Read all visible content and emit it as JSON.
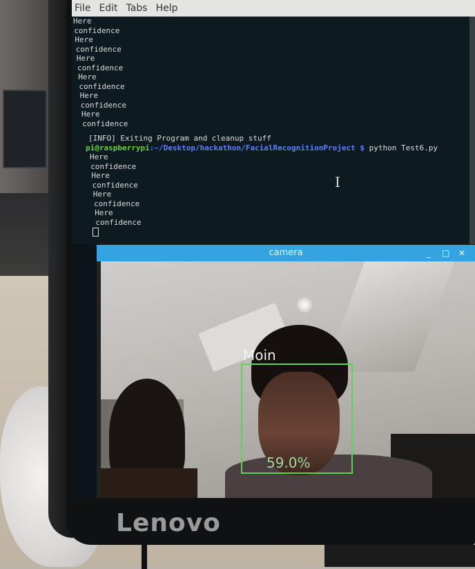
{
  "menu": [
    "File",
    "Edit",
    "Tabs",
    "Help"
  ],
  "terminal": {
    "lines_before": [
      "Here",
      "confidence",
      "Here",
      "confidence",
      "Here",
      "confidence",
      "Here",
      "confidence",
      "Here",
      "confidence",
      "Here",
      "confidence"
    ],
    "info_line": "[INFO] Exiting Program and cleanup stuff",
    "prompt_user": "pi@raspberrypi",
    "prompt_path": ":~/Desktop/hackathon/FacialRecognitionProject $",
    "command": " python Test6.py",
    "lines_after": [
      "Here",
      "confidence",
      "Here",
      "confidence",
      "Here",
      "confidence",
      "Here",
      "confidence"
    ]
  },
  "camera_window": {
    "title": "camera",
    "controls": [
      "_",
      "□",
      "✕"
    ],
    "face_label": "Moin",
    "confidence_label": "59.0%",
    "box_color": "#54d84c"
  },
  "monitor_brand": "Lenovo"
}
